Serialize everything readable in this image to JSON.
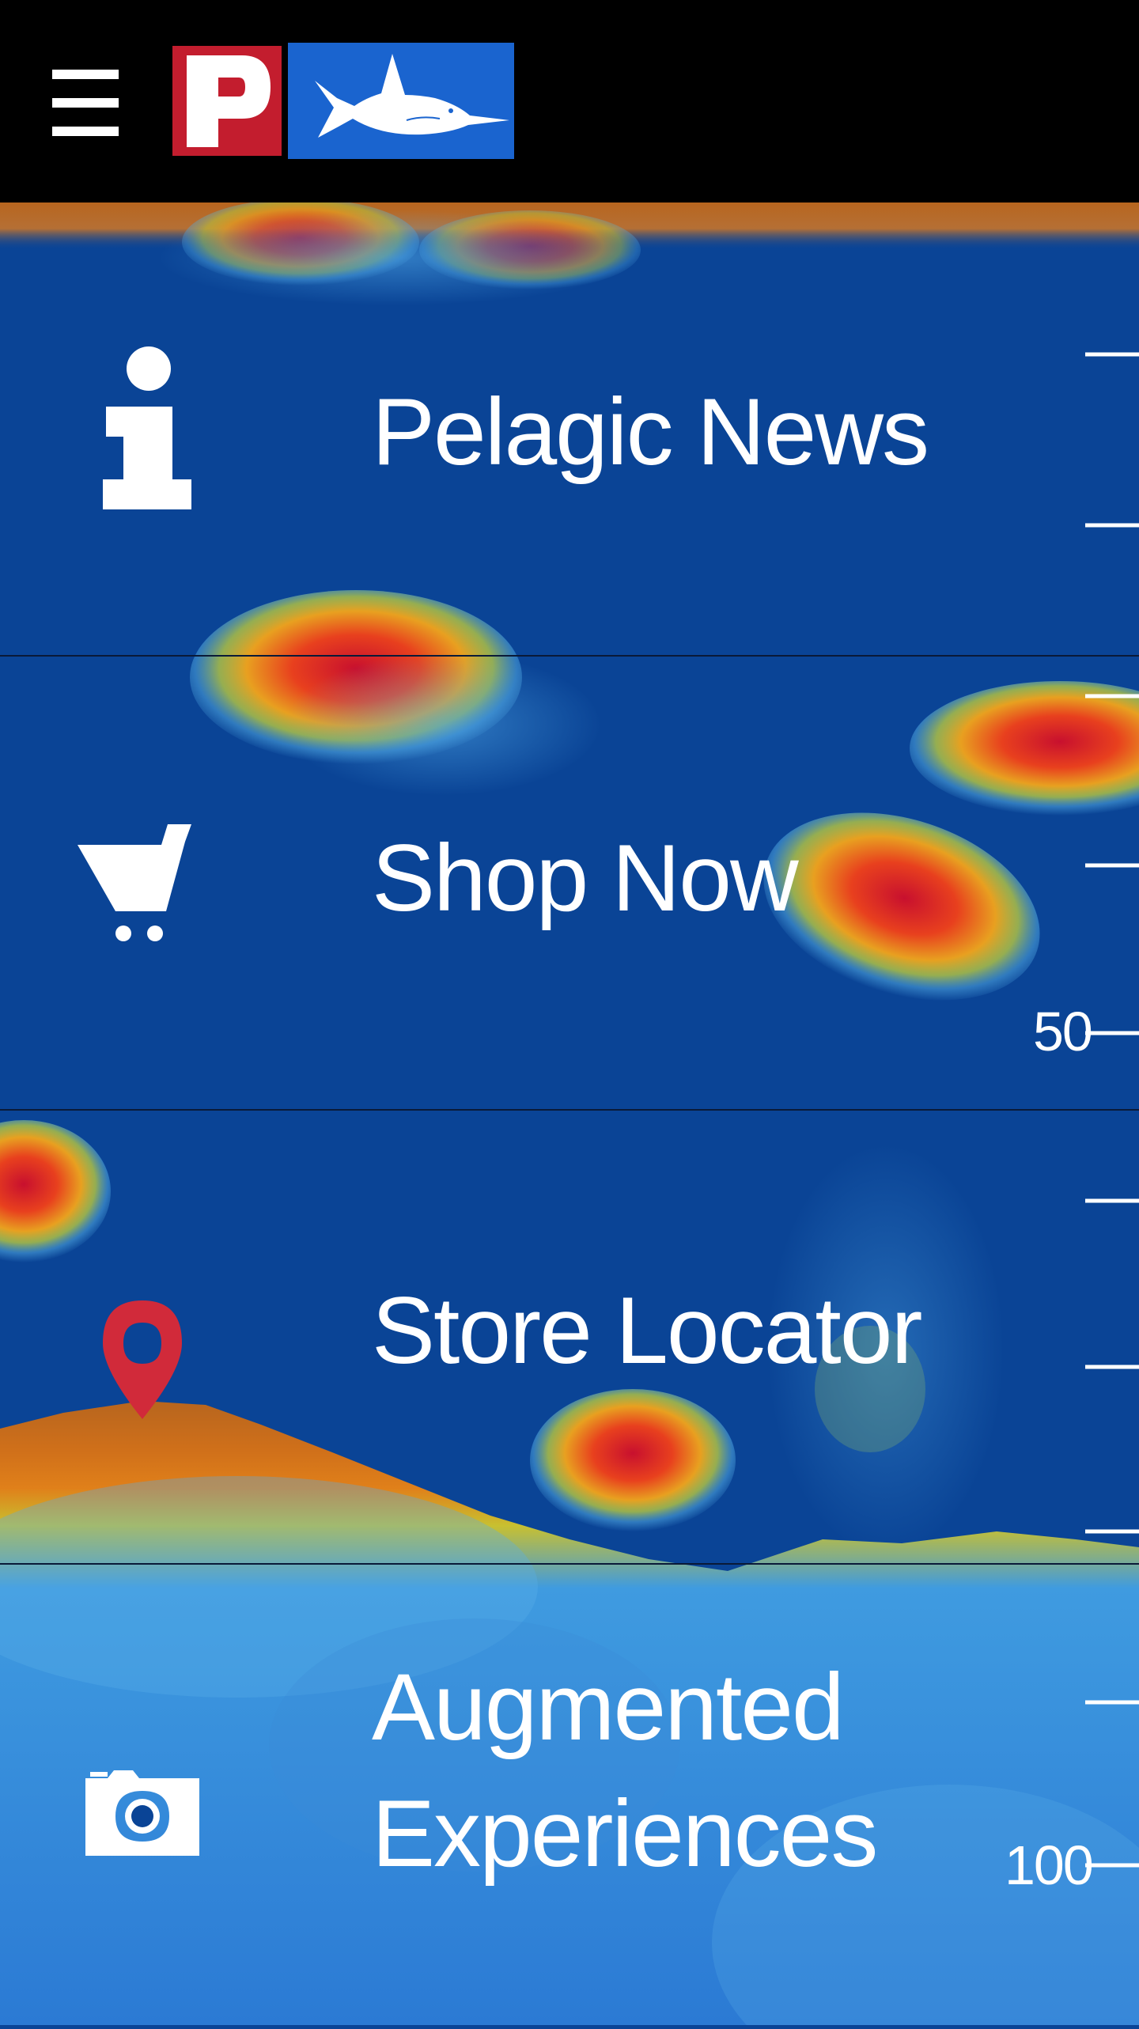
{
  "header": {
    "menu_icon": "hamburger-menu-icon",
    "logo_letter": "P",
    "logo_icon": "marlin-fish-icon",
    "background": "#000000",
    "logo_red": "#c31d2e",
    "logo_blue": "#1a64cf"
  },
  "menu": {
    "items": [
      {
        "label": "Pelagic News",
        "icon": "info-icon"
      },
      {
        "label": "Shop Now",
        "icon": "shopping-cart-icon"
      },
      {
        "label": "Store Locator",
        "icon": "map-pin-icon",
        "icon_color": "#d12a3a"
      },
      {
        "label_line1": "Augmented",
        "label_line2": "Experiences",
        "icon": "camera-icon"
      }
    ]
  },
  "depth_scale": {
    "labels": [
      "50",
      "100"
    ]
  },
  "colors": {
    "water": "#0a4496",
    "text": "#ffffff"
  }
}
